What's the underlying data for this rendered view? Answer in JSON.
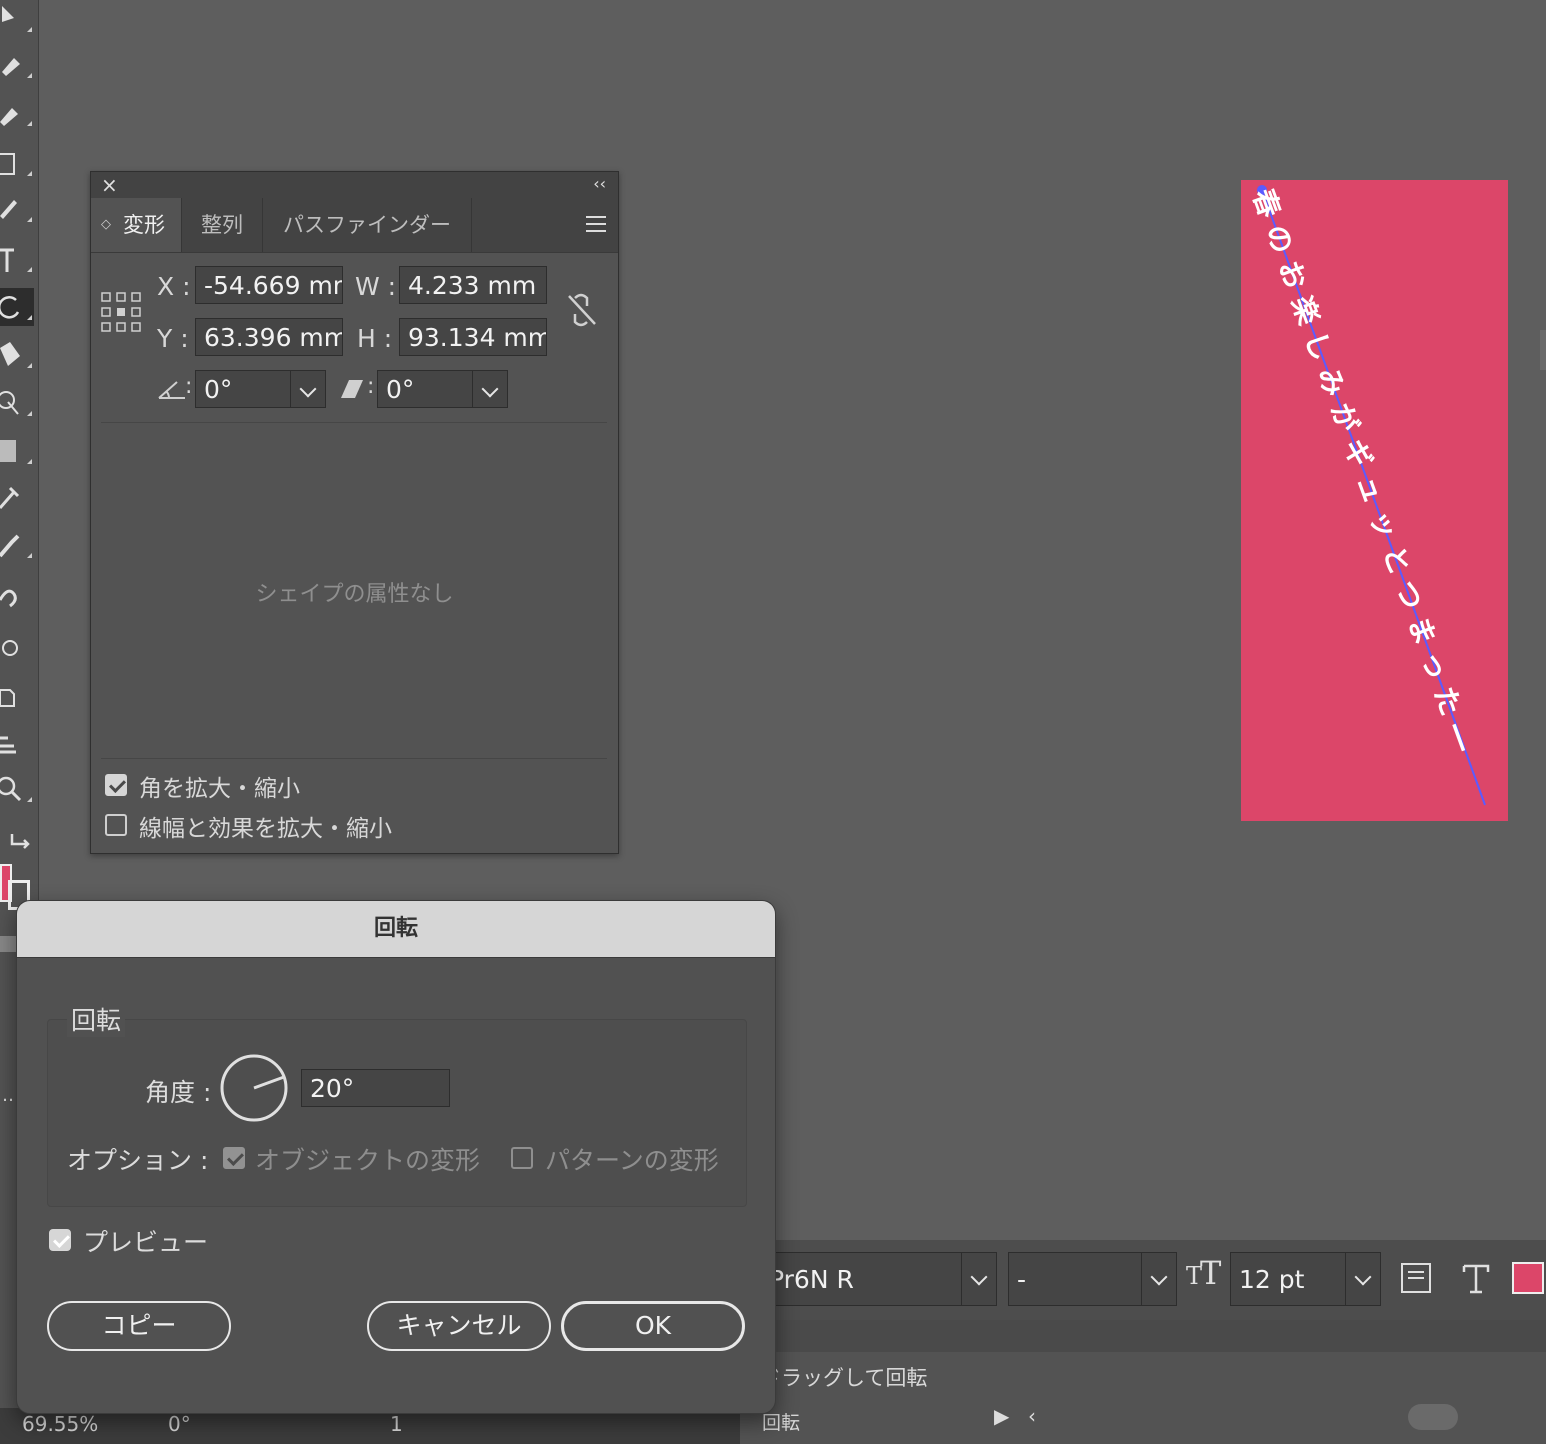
{
  "colors": {
    "artboard": "#dc4669",
    "fill_swatch": "#dc4669",
    "path_line": "#5b5bff"
  },
  "transform_panel": {
    "tabs": [
      "変形",
      "整列",
      "パスファインダー"
    ],
    "x_label": "X :",
    "x_value": "-54.669 mm",
    "y_label": "Y :",
    "y_value": "63.396 mm",
    "w_label": "W :",
    "w_value": "4.233 mm",
    "h_label": "H :",
    "h_value": "93.134 mm",
    "angle_value": "0°",
    "shear_value": "0°",
    "empty_message": "シェイプの属性なし",
    "scale_corners": {
      "label": "角を拡大・縮小",
      "checked": true
    },
    "scale_strokes": {
      "label": "線幅と効果を拡大・縮小",
      "checked": false
    }
  },
  "artwork": {
    "text": "春のお楽しみがギュッとつまった―"
  },
  "control_bar": {
    "font_name": "Pr6N R",
    "font_style": "-",
    "font_size": "12 pt",
    "hint": "ドラッグして回転"
  },
  "status_bar": {
    "zoom": "69.55%",
    "rotation": "0°",
    "artboard_num": "1",
    "tool_name": "回転"
  },
  "rotate_dialog": {
    "title": "回転",
    "group_label": "回転",
    "angle_label": "角度 :",
    "angle_value": "20°",
    "options_label": "オプション :",
    "transform_objects": {
      "label": "オブジェクトの変形",
      "checked": true
    },
    "transform_patterns": {
      "label": "パターンの変形",
      "checked": false
    },
    "preview": {
      "label": "プレビュー",
      "checked": true
    },
    "copy_button": "コピー",
    "cancel_button": "キャンセル",
    "ok_button": "OK"
  }
}
